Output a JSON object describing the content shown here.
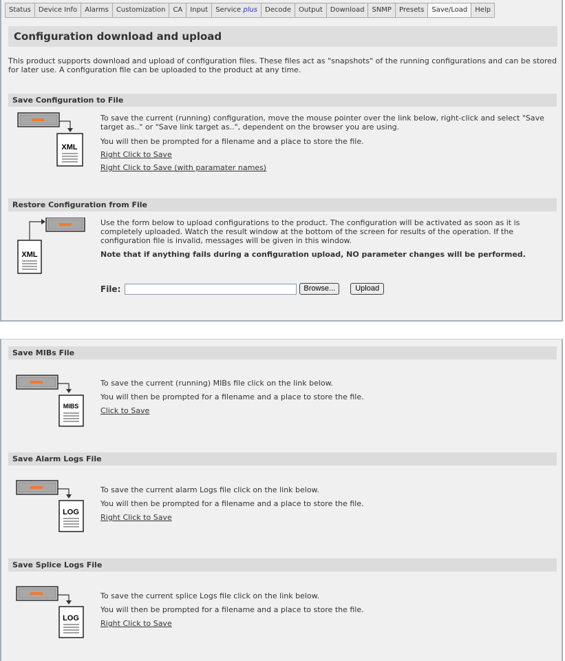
{
  "tabs": [
    {
      "label": "Status"
    },
    {
      "label": "Device Info"
    },
    {
      "label": "Alarms"
    },
    {
      "label": "Customization"
    },
    {
      "label": "CA"
    },
    {
      "label": "Input"
    },
    {
      "label": "Service",
      "suffix": "plus"
    },
    {
      "label": "Decode"
    },
    {
      "label": "Output"
    },
    {
      "label": "Download"
    },
    {
      "label": "SNMP"
    },
    {
      "label": "Presets"
    },
    {
      "label": "Save/Load",
      "active": true
    },
    {
      "label": "Help"
    }
  ],
  "page": {
    "title": "Configuration download and upload",
    "intro": "This product supports download and upload of configuration files. These files act as \"snapshots\" of the running configurations and can be stored for later use. A configuration file can be uploaded to the product at any time."
  },
  "save_config": {
    "header": "Save Configuration to File",
    "text1": "To save the current (running) configuration, move the mouse pointer over the link below, right-click and select \"Save target as..\" or \"Save link target as..\", dependent on the browser you are using.",
    "text2": "You will then be prompted for a filename and a place to store the file.",
    "link1": "Right Click to Save",
    "link2": "Right Click to Save (with paramater names)",
    "icon_label": "XML"
  },
  "restore_config": {
    "header": "Restore Configuration from File",
    "text1": "Use the form below to upload configurations to the product. The configuration will be activated as soon as it is completely uploaded. Watch the result window at the bottom of the screen for results of the operation. If the configuration file is invalid, messages will be given in this window.",
    "note": "Note that if anything fails during a configuration upload, NO parameter changes will be performed.",
    "file_label": "File:",
    "file_value": "",
    "browse_label": "Browse...",
    "upload_label": "Upload",
    "icon_label": "XML"
  },
  "save_mibs": {
    "header": "Save MIBs File",
    "text1": "To save the current (running) MIBs file click on the link below.",
    "text2": "You will then be prompted for a filename and a place to store the file.",
    "link": "Click to Save",
    "icon_label": "MIBS"
  },
  "save_alarm_logs": {
    "header": "Save Alarm Logs File",
    "text1": "To save the current alarm Logs file click on the link below.",
    "text2": "You will then be prompted for a filename and a place to store the file.",
    "link": "Right Click to Save",
    "icon_label": "LOG"
  },
  "save_splice_logs": {
    "header": "Save Splice Logs File",
    "text1": "To save the current splice Logs file click on the link below.",
    "text2": "You will then be prompted for a filename and a place to store the file.",
    "link": "Right Click to Save",
    "icon_label": "LOG"
  },
  "colors": {
    "accent_orange": "#f07a30",
    "plus_blue": "#2233cc",
    "panel_bg": "#f0f0f0",
    "header_bg": "#dcdcdc"
  },
  "icons": [
    "save-to-file-icon",
    "load-from-file-icon",
    "xml-document-icon",
    "mibs-document-icon",
    "log-document-icon"
  ]
}
